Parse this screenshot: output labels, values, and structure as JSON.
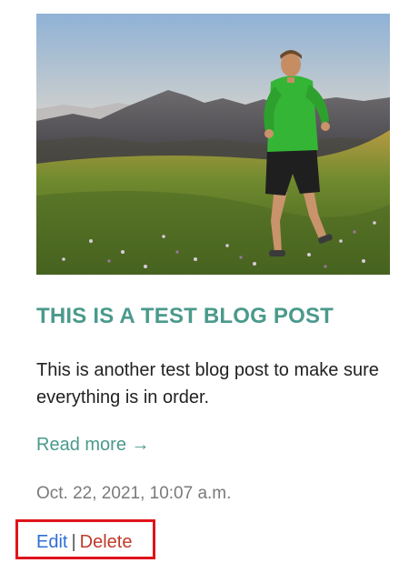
{
  "post": {
    "image_alt": "Trail runner in a green jacket running across a mountain meadow",
    "title": "THIS IS A TEST BLOG POST",
    "excerpt": "This is another test blog post to make sure everything is in order.",
    "read_more": "Read more →",
    "date": "Oct. 22, 2021, 10:07 a.m.",
    "actions": {
      "edit": "Edit",
      "separator": "|",
      "delete": "Delete"
    }
  },
  "colors": {
    "title": "#4a9a8c",
    "read_more": "#4a9a8c",
    "edit": "#2f6fd8",
    "delete": "#c0392b",
    "highlight_border": "#e0141a"
  }
}
